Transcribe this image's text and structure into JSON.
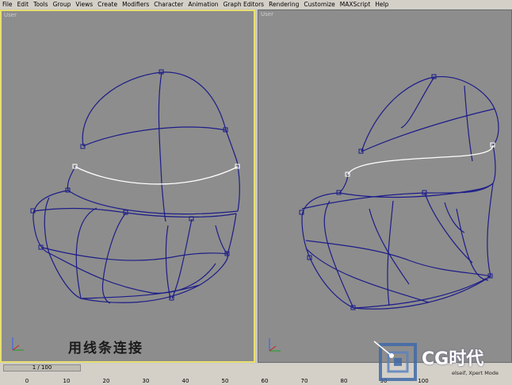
{
  "menu": [
    "File",
    "Edit",
    "Tools",
    "Group",
    "Views",
    "Create",
    "Modifiers",
    "Character",
    "Animation",
    "Graph Editors",
    "Rendering",
    "Customize",
    "MAXScript",
    "Help"
  ],
  "viewports": {
    "left": {
      "label": "User"
    },
    "right": {
      "label": "User"
    }
  },
  "caption": "用线条连接",
  "timeline": {
    "position": "1 / 100"
  },
  "ruler": {
    "ticks": [
      "0",
      "10",
      "20",
      "30",
      "40",
      "50",
      "60",
      "70",
      "80",
      "90",
      "100"
    ]
  },
  "logo": {
    "text": "CG时代",
    "subtext": "elseif, Xpert Mode"
  },
  "colors": {
    "wire": "#1c1c8a",
    "selected": "#ffffff",
    "viewport_bg": "#8d8d8d",
    "active_border": "#e8e070"
  }
}
